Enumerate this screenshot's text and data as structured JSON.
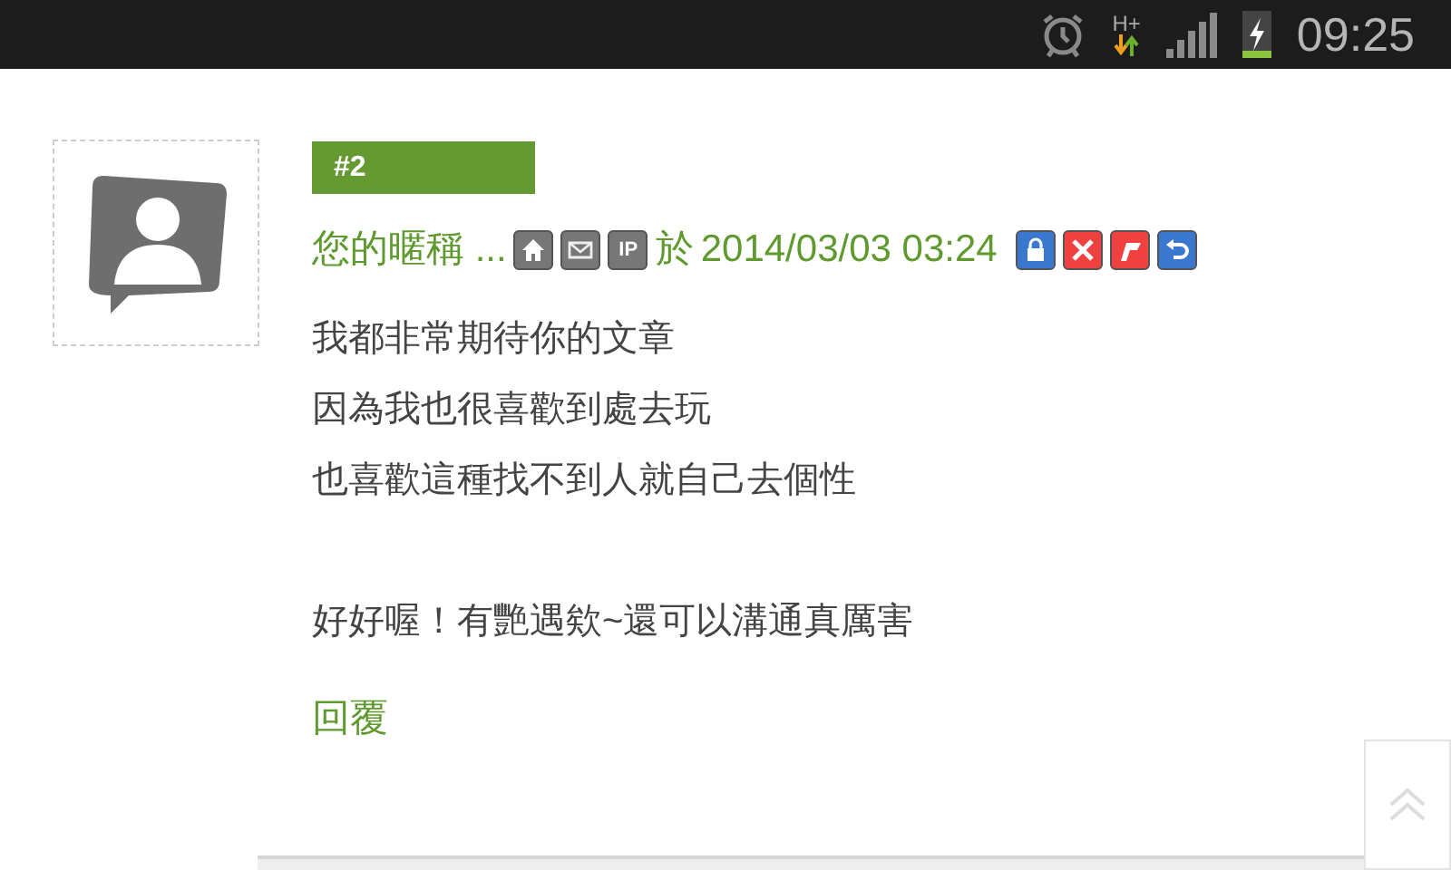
{
  "status_bar": {
    "network": "H+",
    "time": "09:25"
  },
  "post": {
    "number": "#2",
    "author": "您的暱稱 ...",
    "ip_label": "IP",
    "date_prefix": "於",
    "date": "2014/03/03 03:24",
    "paragraphs": [
      [
        "我都非常期待你的文章",
        "因為我也很喜歡到處去玩",
        "也喜歡這種找不到人就自己去個性"
      ],
      [
        "好好喔！有艷遇欸~還可以溝通真厲害"
      ]
    ],
    "reply": "回覆"
  }
}
